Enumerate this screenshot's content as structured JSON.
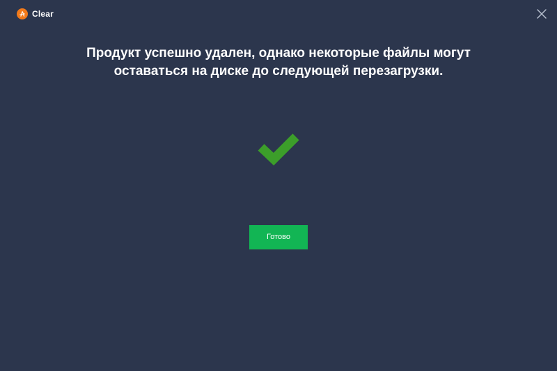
{
  "window": {
    "title": "Clear",
    "logo_icon": "avast-logo-icon",
    "close_icon": "close-icon"
  },
  "main": {
    "message_line1": "Продукт успешно удален, однако некоторые файлы могут",
    "message_line2": "оставаться на диске до следующей перезагрузки.",
    "status_icon": "checkmark-icon",
    "done_label": "Готово"
  },
  "colors": {
    "background": "#2c364d",
    "accent_green": "#12b554",
    "checkmark_green": "#3c9e2a",
    "logo_orange": "#f27a1a"
  }
}
